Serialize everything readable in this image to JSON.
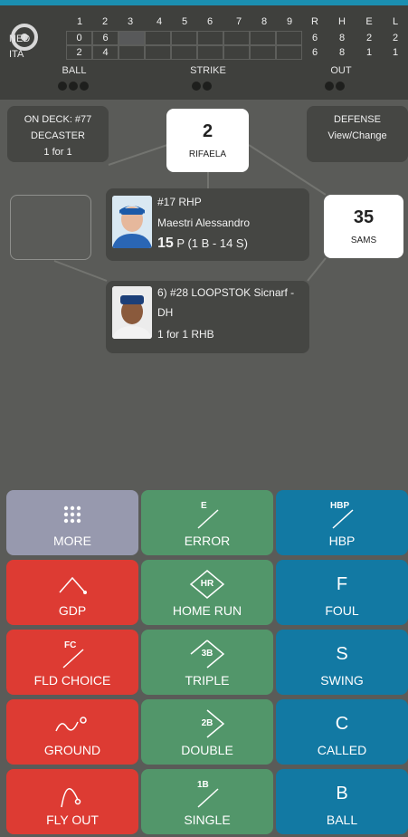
{
  "scoreboard": {
    "innings": [
      "1",
      "2",
      "3",
      "4",
      "5",
      "6",
      "7",
      "8",
      "9"
    ],
    "totals_headers": [
      "R",
      "H",
      "E",
      "L"
    ],
    "away": {
      "team": "NED",
      "scores": [
        "0",
        "6",
        "",
        "",
        "",
        "",
        "",
        "",
        ""
      ],
      "totals": [
        "6",
        "8",
        "2",
        "2"
      ]
    },
    "home": {
      "team": "ITA",
      "scores": [
        "2",
        "4",
        "",
        "",
        "",
        "",
        "",
        "",
        ""
      ],
      "totals": [
        "6",
        "8",
        "1",
        "1"
      ]
    }
  },
  "count": {
    "ball_label": "BALL",
    "strike_label": "STRIKE",
    "out_label": "OUT",
    "balls": 0,
    "balls_max": 3,
    "strikes": 0,
    "strikes_max": 2,
    "outs": 0,
    "outs_max": 2
  },
  "on_deck": {
    "line1": "ON DECK: #77",
    "line2": "DECASTER",
    "line3": "1 for 1"
  },
  "defense": {
    "line1": "DEFENSE",
    "line2": "View/Change"
  },
  "second_base": {
    "number": "2",
    "name": "RIFAELA"
  },
  "first_base": {
    "number": "35",
    "name": "SAMS"
  },
  "pitcher": {
    "line1": "#17 RHP",
    "line2": "Maestri Alessandro",
    "pitch_count": "15",
    "pitch_detail": "P (1 B - 14 S)"
  },
  "batter": {
    "line1": "6) #28 LOOPSTOK Sicnarf -",
    "line2": "DH",
    "line3": "1 for 1 RHB"
  },
  "buttons": {
    "more": "MORE",
    "error": "ERROR",
    "error_tag": "E",
    "hbp": "HBP",
    "hbp_tag": "HBP",
    "gdp": "GDP",
    "home_run": "HOME RUN",
    "home_run_tag": "HR",
    "foul": "FOUL",
    "foul_tag": "F",
    "fld_choice": "FLD CHOICE",
    "fld_choice_tag": "FC",
    "triple": "TRIPLE",
    "triple_tag": "3B",
    "swing": "SWING",
    "swing_tag": "S",
    "ground": "GROUND",
    "double": "DOUBLE",
    "double_tag": "2B",
    "called": "CALLED",
    "called_tag": "C",
    "fly_out": "FLY OUT",
    "single": "SINGLE",
    "single_tag": "1B",
    "ball": "BALL",
    "ball_tag": "B"
  },
  "colors": {
    "out_red": "#dd3b33",
    "hit_green": "#52966a",
    "pitch_blue": "#1279a3",
    "more_gray": "#9799ae",
    "accent": "#1b8fb1"
  }
}
